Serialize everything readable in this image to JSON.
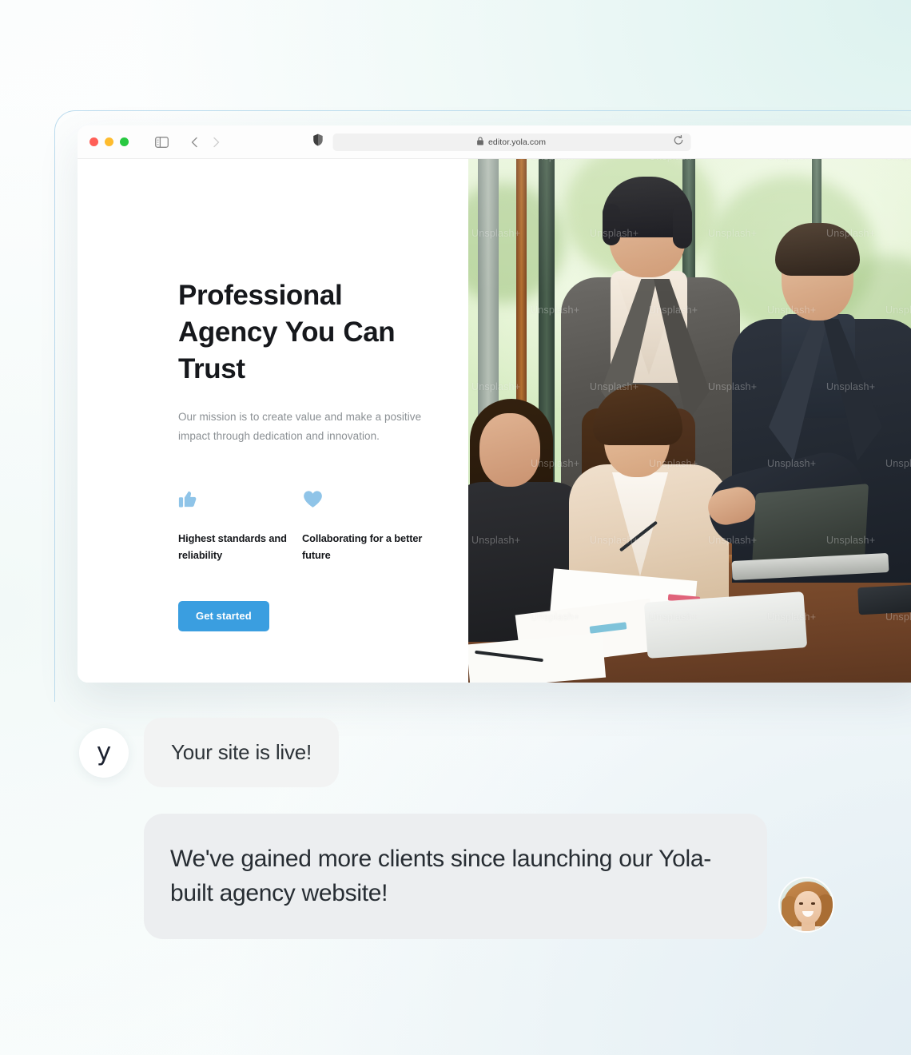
{
  "background": {
    "accent_teal": "#e2f4f1",
    "accent_blue_gray": "#e2edf3",
    "base": "#ffffff"
  },
  "browser": {
    "outline_color": "#bcdcee",
    "traffic_lights": [
      {
        "name": "close",
        "color": "#ff5f57"
      },
      {
        "name": "minimize",
        "color": "#febc2e"
      },
      {
        "name": "zoom",
        "color": "#28c840"
      }
    ],
    "toolbar_icons": [
      "sidebar-toggle-icon",
      "back-chevron-icon",
      "forward-chevron-icon",
      "shield-icon",
      "reload-icon"
    ],
    "address": {
      "url": "editor.yola.com",
      "lock_icon": "lock-icon",
      "reload_icon": "reload-icon"
    }
  },
  "site": {
    "heading": "Professional Agency You Can Trust",
    "subtext": "Our mission is to create value and make a positive impact through dedication and innovation.",
    "features": [
      {
        "icon": "thumbs-up-icon",
        "label": "Highest standards and reliability",
        "color": "#8fc4e8"
      },
      {
        "icon": "heart-icon",
        "label": "Collaborating for a better future",
        "color": "#8fc4e8"
      }
    ],
    "cta": {
      "label": "Get started",
      "color": "#3a9ee0",
      "text_color": "#ffffff"
    },
    "hero_image": {
      "description": "Business team of four colleagues collaborating around a wooden conference table with laptops and printed charts, large windows with green foliage behind",
      "watermark_text": "Unsplash+"
    }
  },
  "chat": {
    "system_message": {
      "avatar_logo": "y",
      "text": "Your site is live!",
      "bubble_color": "#f2f3f3"
    },
    "testimonial": {
      "text": "We've gained more clients since launching our Yola-built agency website!",
      "bubble_color": "#eceef0",
      "avatar": "client-photo-avatar"
    }
  }
}
